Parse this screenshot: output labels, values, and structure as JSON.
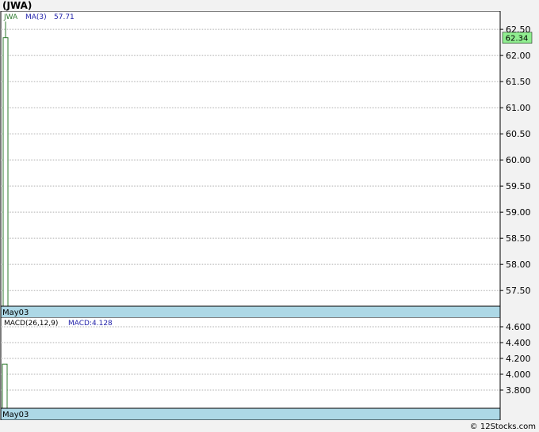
{
  "title": "(JWA)",
  "footer": "© 12Stocks.com",
  "colors": {
    "background": "#f2f2f2",
    "plot_bg": "#ffffff",
    "grid": "#b0b0b0",
    "candle": "#2d7a2d",
    "ma_label": "#2222aa",
    "macd_label": "#2222aa",
    "date_band": "#add8e6",
    "last_price_bg": "#90ee90"
  },
  "chart_data": [
    {
      "type": "bar",
      "panel": "price",
      "ticker_label": "JWA",
      "ma_label": "MA(3)",
      "ma_value": "57.71",
      "last_price_tag": "62.34",
      "ylim": [
        57.2,
        62.85
      ],
      "yticks": [
        "62.50",
        "62.00",
        "61.50",
        "61.00",
        "60.50",
        "60.00",
        "59.50",
        "59.00",
        "58.50",
        "58.00",
        "57.50"
      ],
      "x_label": "May03",
      "candles": [
        {
          "date": "May03",
          "open": 57.2,
          "high": 62.65,
          "low": 57.2,
          "close": 62.34
        }
      ]
    },
    {
      "type": "bar",
      "panel": "macd",
      "label": "MACD(26,12,9)",
      "value_label": "MACD:4.128",
      "ylim": [
        3.57,
        4.72
      ],
      "yticks": [
        "4.600",
        "4.400",
        "4.200",
        "4.000",
        "3.800"
      ],
      "x_label": "May03",
      "bars": [
        {
          "date": "May03",
          "value": 4.128
        }
      ]
    }
  ]
}
